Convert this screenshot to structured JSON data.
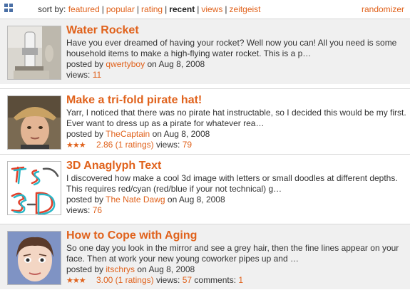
{
  "toolbar": {
    "view_icons": [
      "grid-view-icon",
      "list-view-icon"
    ],
    "sort_label": "sort by:",
    "sort_options": [
      "featured",
      "popular",
      "rating",
      "recent",
      "views",
      "zeitgeist"
    ],
    "active_sort": "recent",
    "randomizer": "randomizer"
  },
  "colors": {
    "accent": "#e0621c",
    "shaded_row": "#f0f0f0",
    "border": "#d8d8d8"
  },
  "items": [
    {
      "title": "Water Rocket",
      "description": "Have you ever dreamed of having your rocket? Well now you can! All you need is some household items to make a high-flying water rocket. This is a p…",
      "posted_by_label": "posted by",
      "author": "qwertyboy",
      "date_prefix": "on",
      "date": "Aug 8, 2008",
      "views_label": "views:",
      "views": "11",
      "thumbnail": "water-rocket-photo"
    },
    {
      "title": "Make a tri-fold pirate hat!",
      "description": "Yarr, I noticed that there was no pirate hat instructable, so I decided this would be my first. Ever want to dress up as a pirate for whatever rea…",
      "posted_by_label": "posted by",
      "author": "TheCaptain",
      "date_prefix": "on",
      "date": "Aug 8, 2008",
      "stars": "★★★",
      "rating": "2.86 (1 ratings)",
      "rating_value": 2.86,
      "views_label": "views:",
      "views": "79",
      "thumbnail": "pirate-hat-photo"
    },
    {
      "title": "3D Anaglyph Text",
      "description": "I discovered how make a cool 3d image with letters or small doodles at different depths. This requires red/cyan (red/blue if your not technical) g…",
      "posted_by_label": "posted by",
      "author": "The Nate Dawg",
      "date_prefix": "on",
      "date": "Aug 8, 2008",
      "views_label": "views:",
      "views": "76",
      "thumbnail": "anaglyph-text-image"
    },
    {
      "title": "How to Cope with Aging",
      "description": "So one day you look in the mirror and see a grey hair, then the fine lines appear on your face. Then at work your new young coworker pipes up and …",
      "posted_by_label": "posted by",
      "author": "itschrys",
      "date_prefix": "on",
      "date": "Aug 8, 2008",
      "stars": "★★★",
      "rating": "3.00 (1 ratings)",
      "rating_value": 3.0,
      "views_label": "views:",
      "views": "57",
      "comments_label": "comments:",
      "comments": "1",
      "thumbnail": "cartoon-face-image"
    }
  ]
}
